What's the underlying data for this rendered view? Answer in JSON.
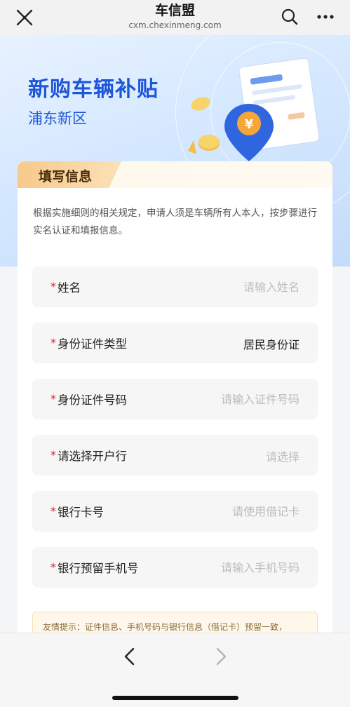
{
  "browser": {
    "title": "车信盟",
    "domain": "cxm.chexinmeng.com",
    "icons": [
      "close-icon",
      "search-icon",
      "more-icon"
    ]
  },
  "hero": {
    "title": "新购车辆补贴",
    "subtitle": "浦东新区",
    "badge_symbol": "¥"
  },
  "form": {
    "section_title": "填写信息",
    "intro": "根据实施细则的相关规定，申请人须是车辆所有人本人，按步骤进行实名认证和填报信息。",
    "required_mark": "*",
    "fields": [
      {
        "label": "姓名",
        "placeholder": "请输入姓名"
      },
      {
        "label": "身份证件类型",
        "value": "居民身份证"
      },
      {
        "label": "身份证件号码",
        "placeholder": "请输入证件号码"
      },
      {
        "label": "请选择开户行",
        "placeholder": "请选择"
      },
      {
        "label": "银行卡号",
        "placeholder": "请使用借记卡"
      },
      {
        "label": "银行预留手机号",
        "placeholder": "请输入手机号码"
      }
    ],
    "tip": "友情提示：证件信息、手机号码与银行信息（借记卡）预留一致，"
  },
  "colors": {
    "accent": "#1d56d8",
    "required": "#e02020",
    "tab": "#f7c98b"
  },
  "bottom": {
    "icons": [
      "back-arrow-icon",
      "forward-arrow-icon"
    ]
  }
}
